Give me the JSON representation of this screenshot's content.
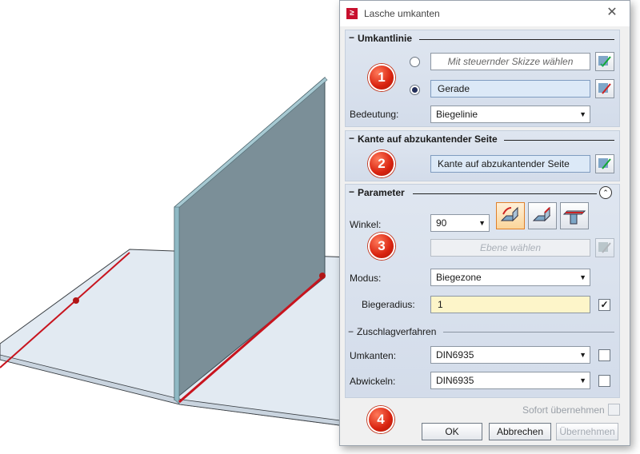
{
  "dialog": {
    "title": "Lasche umkanten",
    "close_glyph": "✕",
    "app_icon_glyph": "≥",
    "sections": {
      "umkantlinie": {
        "dash": "−",
        "title": "Umkantlinie",
        "badge": "1",
        "option1_placeholder": "Mit steuernder Skizze wählen",
        "option2_value": "Gerade",
        "option_selected": 2,
        "bedeutung_label": "Bedeutung:",
        "bedeutung_value": "Biegelinie"
      },
      "kante": {
        "dash": "−",
        "title": "Kante auf abzukantender Seite",
        "badge": "2",
        "field_value": "Kante auf abzukantender Seite"
      },
      "parameter": {
        "dash": "−",
        "title": "Parameter",
        "badge": "3",
        "collapse_glyph": "⌃",
        "winkel_label": "Winkel:",
        "winkel_value": "90",
        "ebene_placeholder": "Ebene wählen",
        "modus_label": "Modus:",
        "modus_value": "Biegezone",
        "biegeradius_label": "Biegeradius:",
        "biegeradius_value": "1",
        "biegeradius_checked": true,
        "zuschlag_dash": "−",
        "zuschlag_title": "Zuschlagverfahren",
        "umkanten_label": "Umkanten:",
        "umkanten_value": "DIN6935",
        "abwickeln_label": "Abwickeln:",
        "abwickeln_value": "DIN6935"
      }
    },
    "footer": {
      "badge": "4",
      "sofort_label": "Sofort übernehmen",
      "ok_label": "OK",
      "abbrechen_label": "Abbrechen",
      "uebernehmen_label": "Übernehmen"
    },
    "check_glyph": "✓",
    "arrow_glyph": "▼"
  },
  "colors": {
    "accent_red": "#d8220f",
    "edge_red": "#c8141e",
    "sheet_blue": "#dfe8f1",
    "wall_gray": "#7a8d96"
  }
}
